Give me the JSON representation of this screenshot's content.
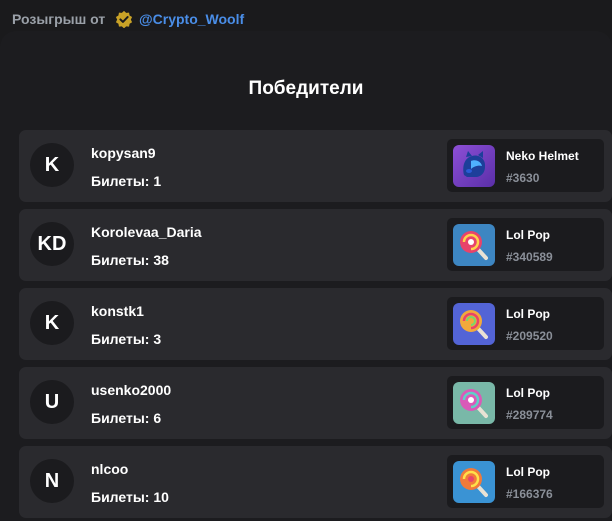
{
  "header": {
    "title": "Розыгрыш от",
    "handle": "@Crypto_Woolf",
    "verified_icon": "verified-badge-icon",
    "accent": "#4a8ee8"
  },
  "panel": {
    "heading": "Победители"
  },
  "winners": [
    {
      "initials": "K",
      "username": "kopysan9",
      "tickets": "Билеты: 1",
      "prize": {
        "name": "Neko Helmet",
        "number": "#3630",
        "icon": "neko-helmet-icon"
      }
    },
    {
      "initials": "KD",
      "username": "Korolevaa_Daria",
      "tickets": "Билеты: 38",
      "prize": {
        "name": "Lol Pop",
        "number": "#340589",
        "icon": "lollipop-icon"
      }
    },
    {
      "initials": "K",
      "username": "konstk1",
      "tickets": "Билеты: 3",
      "prize": {
        "name": "Lol Pop",
        "number": "#209520",
        "icon": "lollipop-icon"
      }
    },
    {
      "initials": "U",
      "username": "usenko2000",
      "tickets": "Билеты: 6",
      "prize": {
        "name": "Lol Pop",
        "number": "#289774",
        "icon": "lollipop-icon"
      }
    },
    {
      "initials": "N",
      "username": "nlcoo",
      "tickets": "Билеты: 10",
      "prize": {
        "name": "Lol Pop",
        "number": "#166376",
        "icon": "lollipop-icon"
      }
    }
  ]
}
